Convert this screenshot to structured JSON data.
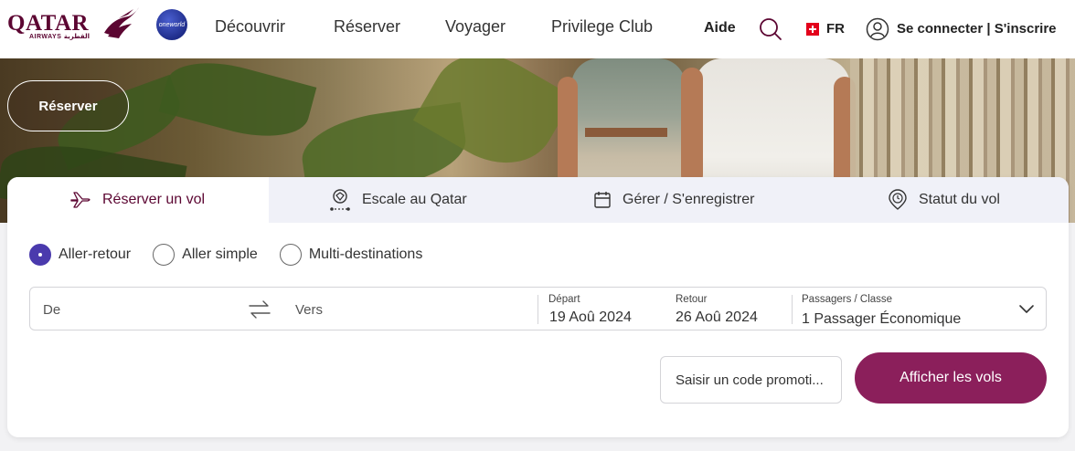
{
  "header": {
    "logo_text": "QATAR",
    "logo_sub": "AIRWAYS القطرية",
    "oneworld_text": "oneworld",
    "nav": [
      "Découvrir",
      "Réserver",
      "Voyager",
      "Privilege Club"
    ],
    "help": "Aide",
    "language": "FR",
    "login": "Se connecter | S'inscrire"
  },
  "hero": {
    "reserve_button": "Réserver"
  },
  "booking": {
    "tabs": [
      {
        "label": "Réserver un vol",
        "icon": "plane-icon",
        "active": true
      },
      {
        "label": "Escale au Qatar",
        "icon": "stopover-icon",
        "active": false
      },
      {
        "label": "Gérer / S'enregistrer",
        "icon": "calendar-icon",
        "active": false
      },
      {
        "label": "Statut du vol",
        "icon": "clock-pin-icon",
        "active": false
      }
    ],
    "trip_types": [
      {
        "label": "Aller-retour",
        "checked": true
      },
      {
        "label": "Aller simple",
        "checked": false
      },
      {
        "label": "Multi-destinations",
        "checked": false
      }
    ],
    "from_placeholder": "De",
    "to_placeholder": "Vers",
    "departure_label": "Départ",
    "departure_value": "19 Aoû 2024",
    "return_label": "Retour",
    "return_value": "26 Aoû 2024",
    "passengers_label": "Passagers / Classe",
    "passengers_value": "1 Passager Économique",
    "promo_placeholder": "Saisir un code promoti...",
    "show_flights": "Afficher les vols"
  },
  "colors": {
    "brand": "#5c0632",
    "button": "#8b1f5b",
    "radio_selected": "#4a3aad"
  }
}
